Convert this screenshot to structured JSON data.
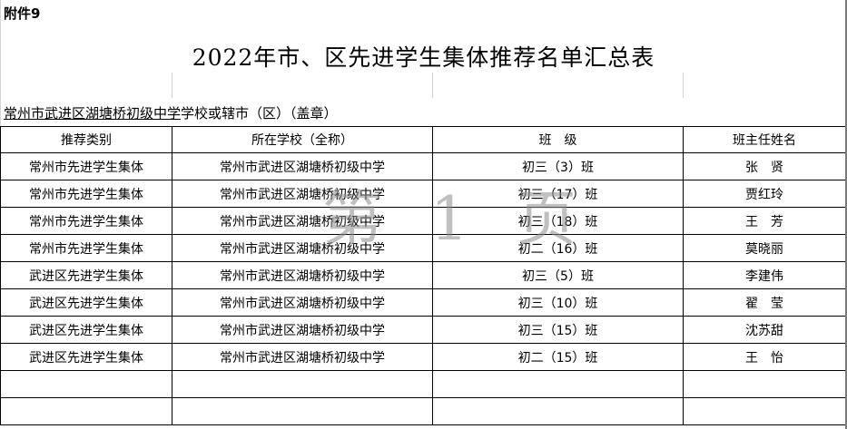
{
  "attachment_label": "附件9",
  "title": "2022年市、区先进学生集体推荐名单汇总表",
  "unit_line": {
    "unit_name": "常州市武进区湖塘桥初级中学",
    "suffix": "学校或辖市（区）（盖章）"
  },
  "table": {
    "headers": [
      "推荐类别",
      "所在学校（全称）",
      "班　级",
      "班主任姓名"
    ],
    "rows": [
      [
        "常州市先进学生集体",
        "常州市武进区湖塘桥初级中学",
        "初三（3）班",
        "张　贤"
      ],
      [
        "常州市先进学生集体",
        "常州市武进区湖塘桥初级中学",
        "初三（17）班",
        "贾红玲"
      ],
      [
        "常州市先进学生集体",
        "常州市武进区湖塘桥初级中学",
        "初三（18）班",
        "王　芳"
      ],
      [
        "常州市先进学生集体",
        "常州市武进区湖塘桥初级中学",
        "初二（16）班",
        "莫晓丽"
      ],
      [
        "武进区先进学生集体",
        "常州市武进区湖塘桥初级中学",
        "初三（5）班",
        "李建伟"
      ],
      [
        "武进区先进学生集体",
        "常州市武进区湖塘桥初级中学",
        "初三（10）班",
        "翟　莹"
      ],
      [
        "武进区先进学生集体",
        "常州市武进区湖塘桥初级中学",
        "初三（15）班",
        "沈苏甜"
      ],
      [
        "武进区先进学生集体",
        "常州市武进区湖塘桥初级中学",
        "初二（15）班",
        "王　怡"
      ],
      [
        "",
        "",
        "",
        ""
      ],
      [
        "",
        "",
        "",
        ""
      ]
    ]
  },
  "watermark": "第 1 页"
}
